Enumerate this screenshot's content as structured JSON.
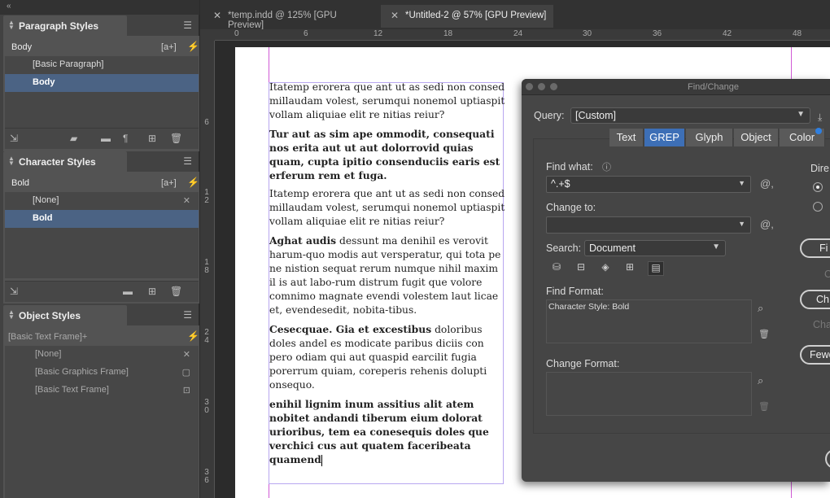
{
  "collapse_icon": "«",
  "paragraph_styles": {
    "title": "Paragraph Styles",
    "current": "Body",
    "new_from_selection": "[a+]",
    "items": [
      {
        "label": "[Basic Paragraph]",
        "selected": false
      },
      {
        "label": "Body",
        "selected": true
      }
    ]
  },
  "character_styles": {
    "title": "Character Styles",
    "current": "Bold",
    "new_from_selection": "[a+]",
    "items": [
      {
        "label": "[None]",
        "selected": false
      },
      {
        "label": "Bold",
        "selected": true
      }
    ]
  },
  "object_styles": {
    "title": "Object Styles",
    "current": "[Basic Text Frame]+",
    "items": [
      {
        "label": "[None]"
      },
      {
        "label": "[Basic Graphics Frame]"
      },
      {
        "label": "[Basic Text Frame]"
      }
    ]
  },
  "doc_tabs": [
    {
      "label": "*temp.indd @ 125% [GPU Preview]",
      "active": false
    },
    {
      "label": "*Untitled-2 @ 57% [GPU Preview]",
      "active": true
    }
  ],
  "ruler": {
    "h_ticks": [
      "0",
      "6",
      "12",
      "18",
      "24",
      "30",
      "36",
      "42",
      "48"
    ],
    "v_ticks": [
      "6",
      "1\n2",
      "1\n8",
      "2\n4",
      "3\n0",
      "3\n6"
    ]
  },
  "story": {
    "p1": "Itatemp erorera que ant ut as sedi non consed millaudam volest, serumqui nonemol uptiaspit vollam aliquiae elit re nitias reiur?",
    "p2": "Tur aut as sim ape ommodit, consequati nos erita aut ut aut dolorrovid quias quam, cupta ipitio consenduciis earis est erferum rem et fuga.",
    "p3": "Itatemp erorera que ant ut as sedi non consed millaudam volest, serumqui nonemol uptiaspit vollam aliquiae elit re nitias reiur?",
    "p4_bold": "Aghat audis",
    "p4_rest": " dessunt ma denihil es verovit harum-quo modis aut versperatur, qui tota pe ne nistion sequat rerum numque nihil maxim il is aut labo-rum distrum fugit que volore comnimo magnate evendi volestem laut licae et, evendesedit, nobita-tibus.",
    "p5_bold": "Cesecquae. Gia et excestibus",
    "p5_rest": " doloribus doles andel es modicate paribus diciis con pero odiam qui aut quaspid earcilit fugia porerrum quiam, coreperis rehenis dolupti onsequo.",
    "p6": "enihil lignim inum assitius alit atem nobitet andandi tiberum eium dolorat urioribus, tem ea conesequis doles que verchici cus aut quatem faceribeata quamend"
  },
  "find_change": {
    "title": "Find/Change",
    "query_label": "Query:",
    "query_value": "[Custom]",
    "tabs": [
      {
        "label": "Text",
        "active": false
      },
      {
        "label": "GREP",
        "active": true
      },
      {
        "label": "Glyph",
        "active": false
      },
      {
        "label": "Object",
        "active": false
      },
      {
        "label": "Color",
        "active": false
      }
    ],
    "find_what_label": "Find what:",
    "find_what_value": "^.+$",
    "change_to_label": "Change to:",
    "change_to_value": "",
    "search_label": "Search:",
    "search_value": "Document",
    "find_format_label": "Find Format:",
    "find_format_value": "Character Style: Bold",
    "change_format_label": "Change Format:",
    "change_format_value": "",
    "direction_label": "Dire",
    "buttons": {
      "find": "Fi",
      "change": "Ch",
      "change_all_ghost": "Cha",
      "change_find_ghost": "C",
      "fewer": "Fewe"
    }
  },
  "colors": {
    "selection": "#4b6384",
    "active_tab": "#3d6fb6",
    "guide": "#d15bd6",
    "frame": "#b8a7f0"
  }
}
